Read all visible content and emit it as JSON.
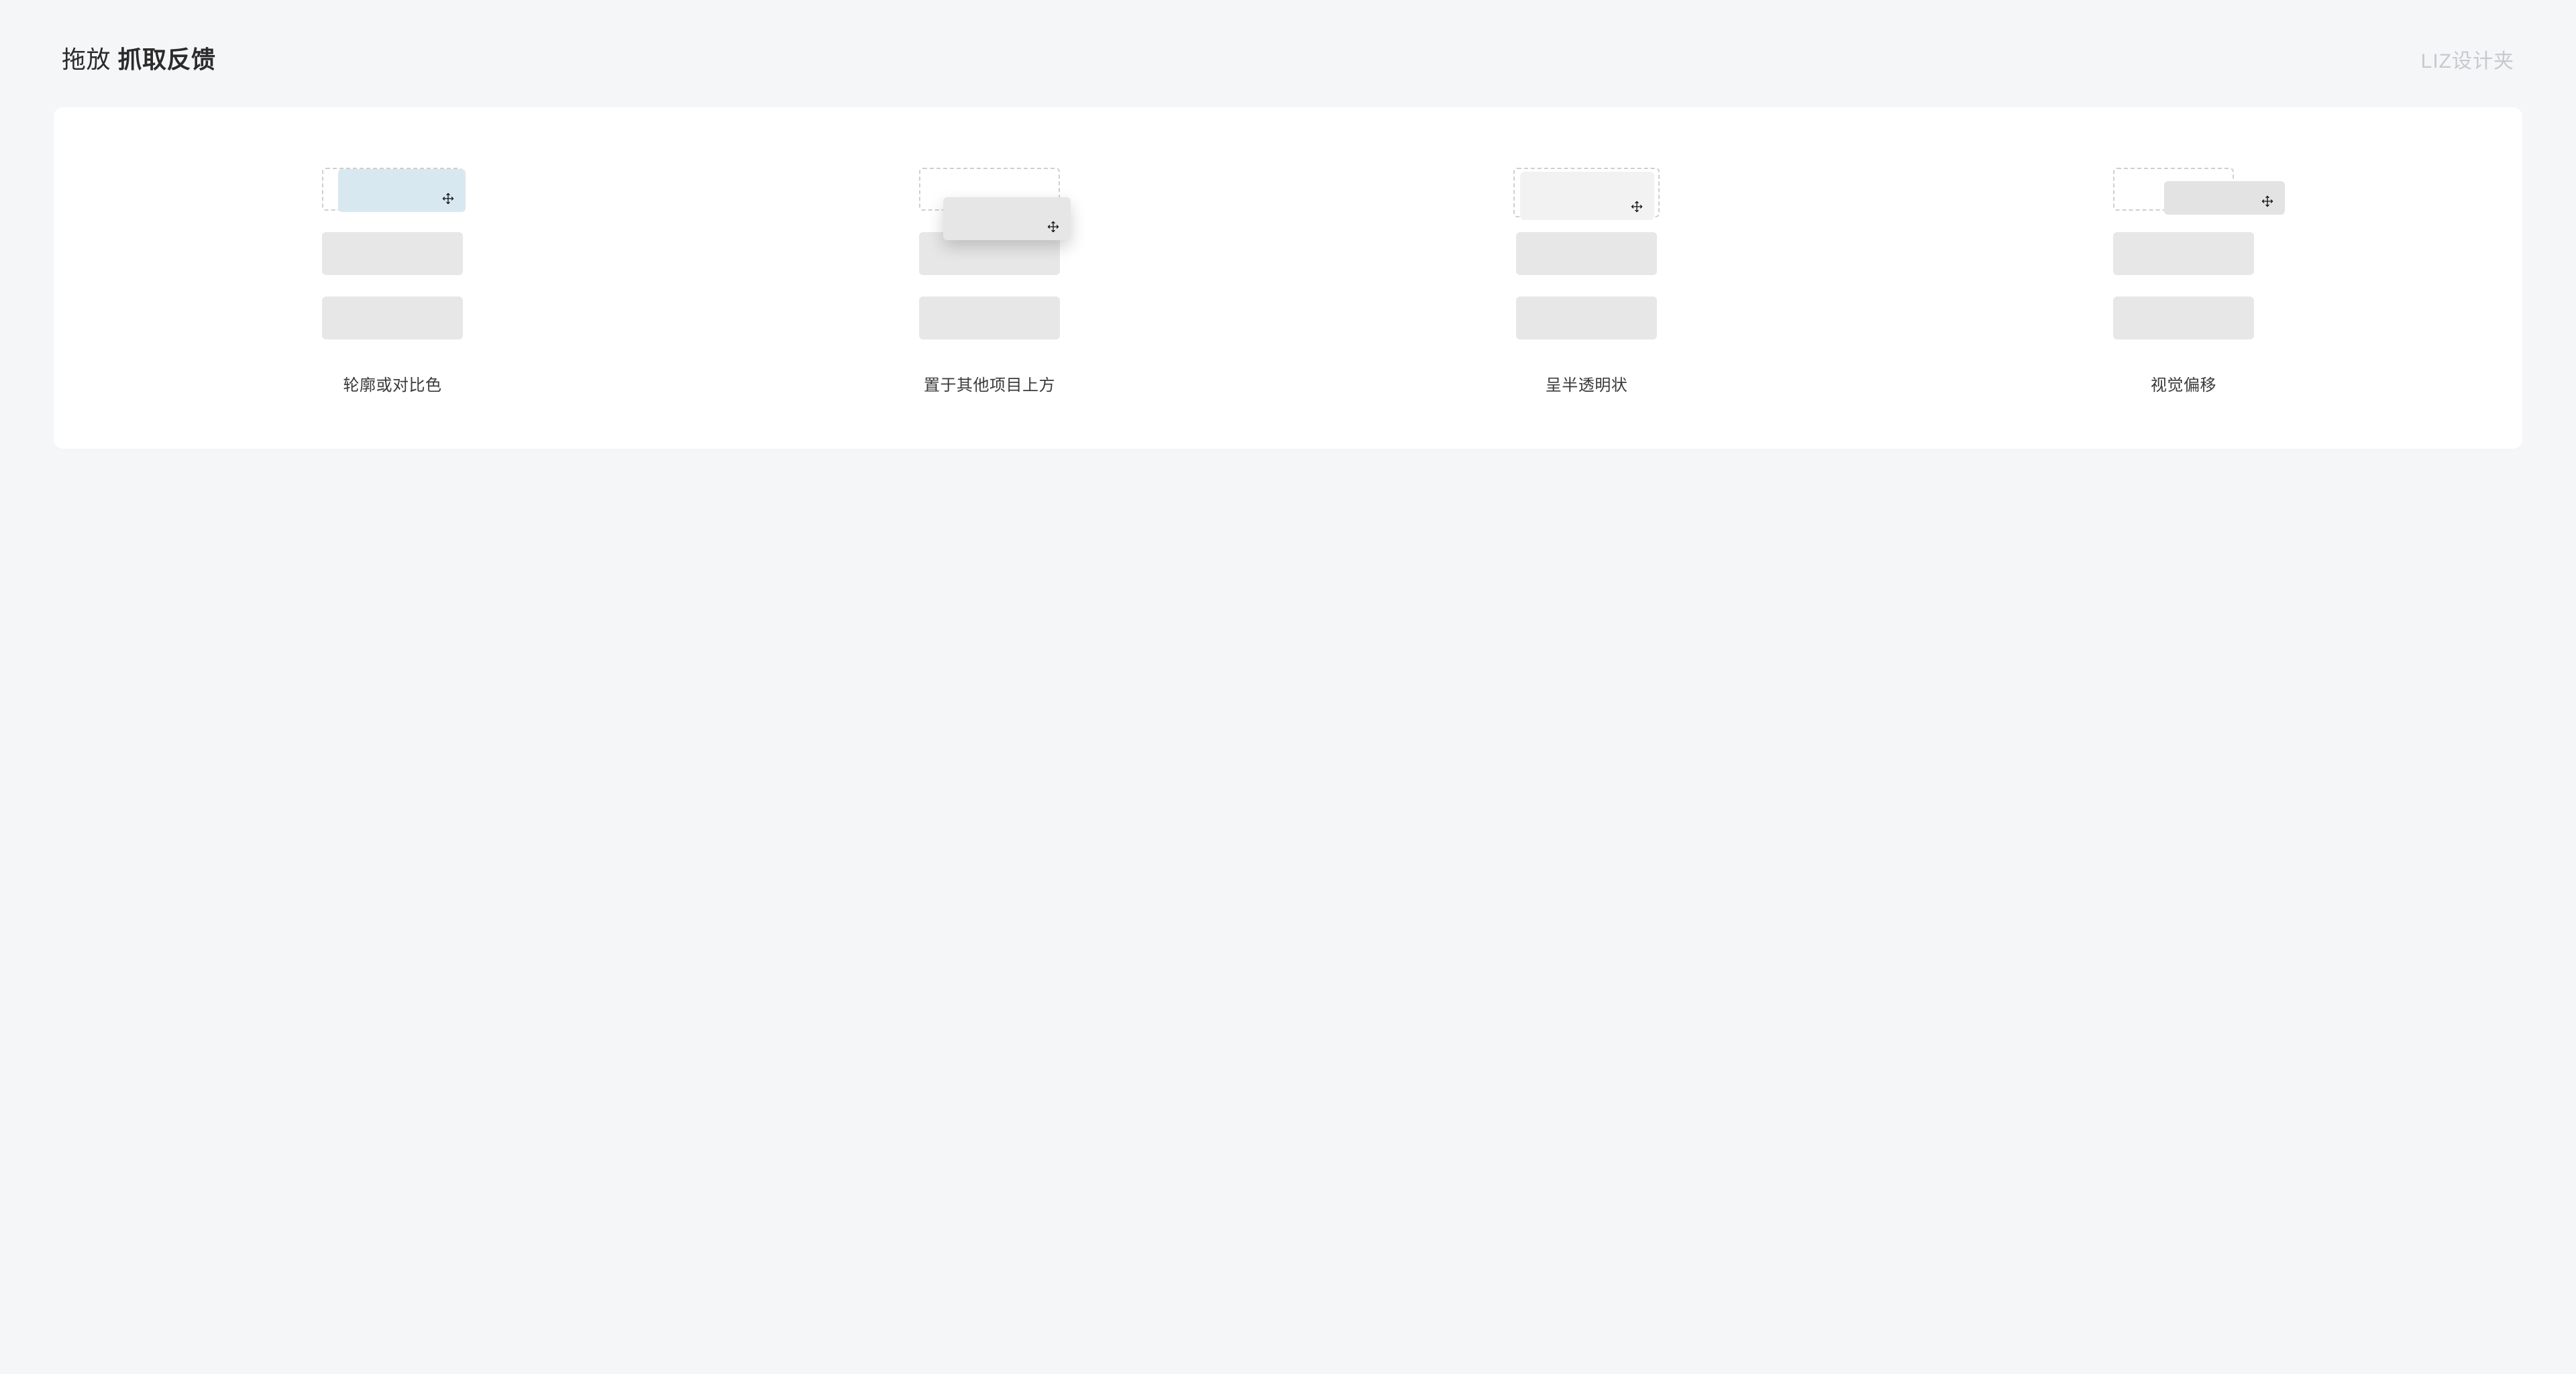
{
  "header": {
    "title_prefix": "拖放",
    "title_bold": "抓取反馈",
    "brand": "LIZ设计夹"
  },
  "variants": [
    {
      "caption": "轮廓或对比色"
    },
    {
      "caption": "置于其他项目上方"
    },
    {
      "caption": "呈半透明状"
    },
    {
      "caption": "视觉偏移"
    }
  ],
  "icons": {
    "move": "move-icon"
  }
}
